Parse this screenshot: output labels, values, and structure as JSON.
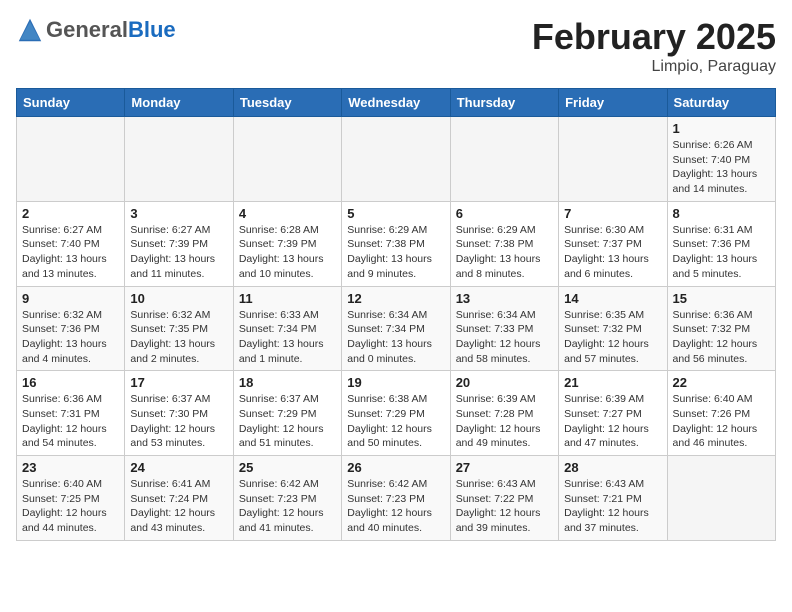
{
  "header": {
    "logo_general": "General",
    "logo_blue": "Blue",
    "month_title": "February 2025",
    "location": "Limpio, Paraguay"
  },
  "days_of_week": [
    "Sunday",
    "Monday",
    "Tuesday",
    "Wednesday",
    "Thursday",
    "Friday",
    "Saturday"
  ],
  "weeks": [
    [
      {
        "day": "",
        "info": ""
      },
      {
        "day": "",
        "info": ""
      },
      {
        "day": "",
        "info": ""
      },
      {
        "day": "",
        "info": ""
      },
      {
        "day": "",
        "info": ""
      },
      {
        "day": "",
        "info": ""
      },
      {
        "day": "1",
        "info": "Sunrise: 6:26 AM\nSunset: 7:40 PM\nDaylight: 13 hours and 14 minutes."
      }
    ],
    [
      {
        "day": "2",
        "info": "Sunrise: 6:27 AM\nSunset: 7:40 PM\nDaylight: 13 hours and 13 minutes."
      },
      {
        "day": "3",
        "info": "Sunrise: 6:27 AM\nSunset: 7:39 PM\nDaylight: 13 hours and 11 minutes."
      },
      {
        "day": "4",
        "info": "Sunrise: 6:28 AM\nSunset: 7:39 PM\nDaylight: 13 hours and 10 minutes."
      },
      {
        "day": "5",
        "info": "Sunrise: 6:29 AM\nSunset: 7:38 PM\nDaylight: 13 hours and 9 minutes."
      },
      {
        "day": "6",
        "info": "Sunrise: 6:29 AM\nSunset: 7:38 PM\nDaylight: 13 hours and 8 minutes."
      },
      {
        "day": "7",
        "info": "Sunrise: 6:30 AM\nSunset: 7:37 PM\nDaylight: 13 hours and 6 minutes."
      },
      {
        "day": "8",
        "info": "Sunrise: 6:31 AM\nSunset: 7:36 PM\nDaylight: 13 hours and 5 minutes."
      }
    ],
    [
      {
        "day": "9",
        "info": "Sunrise: 6:32 AM\nSunset: 7:36 PM\nDaylight: 13 hours and 4 minutes."
      },
      {
        "day": "10",
        "info": "Sunrise: 6:32 AM\nSunset: 7:35 PM\nDaylight: 13 hours and 2 minutes."
      },
      {
        "day": "11",
        "info": "Sunrise: 6:33 AM\nSunset: 7:34 PM\nDaylight: 13 hours and 1 minute."
      },
      {
        "day": "12",
        "info": "Sunrise: 6:34 AM\nSunset: 7:34 PM\nDaylight: 13 hours and 0 minutes."
      },
      {
        "day": "13",
        "info": "Sunrise: 6:34 AM\nSunset: 7:33 PM\nDaylight: 12 hours and 58 minutes."
      },
      {
        "day": "14",
        "info": "Sunrise: 6:35 AM\nSunset: 7:32 PM\nDaylight: 12 hours and 57 minutes."
      },
      {
        "day": "15",
        "info": "Sunrise: 6:36 AM\nSunset: 7:32 PM\nDaylight: 12 hours and 56 minutes."
      }
    ],
    [
      {
        "day": "16",
        "info": "Sunrise: 6:36 AM\nSunset: 7:31 PM\nDaylight: 12 hours and 54 minutes."
      },
      {
        "day": "17",
        "info": "Sunrise: 6:37 AM\nSunset: 7:30 PM\nDaylight: 12 hours and 53 minutes."
      },
      {
        "day": "18",
        "info": "Sunrise: 6:37 AM\nSunset: 7:29 PM\nDaylight: 12 hours and 51 minutes."
      },
      {
        "day": "19",
        "info": "Sunrise: 6:38 AM\nSunset: 7:29 PM\nDaylight: 12 hours and 50 minutes."
      },
      {
        "day": "20",
        "info": "Sunrise: 6:39 AM\nSunset: 7:28 PM\nDaylight: 12 hours and 49 minutes."
      },
      {
        "day": "21",
        "info": "Sunrise: 6:39 AM\nSunset: 7:27 PM\nDaylight: 12 hours and 47 minutes."
      },
      {
        "day": "22",
        "info": "Sunrise: 6:40 AM\nSunset: 7:26 PM\nDaylight: 12 hours and 46 minutes."
      }
    ],
    [
      {
        "day": "23",
        "info": "Sunrise: 6:40 AM\nSunset: 7:25 PM\nDaylight: 12 hours and 44 minutes."
      },
      {
        "day": "24",
        "info": "Sunrise: 6:41 AM\nSunset: 7:24 PM\nDaylight: 12 hours and 43 minutes."
      },
      {
        "day": "25",
        "info": "Sunrise: 6:42 AM\nSunset: 7:23 PM\nDaylight: 12 hours and 41 minutes."
      },
      {
        "day": "26",
        "info": "Sunrise: 6:42 AM\nSunset: 7:23 PM\nDaylight: 12 hours and 40 minutes."
      },
      {
        "day": "27",
        "info": "Sunrise: 6:43 AM\nSunset: 7:22 PM\nDaylight: 12 hours and 39 minutes."
      },
      {
        "day": "28",
        "info": "Sunrise: 6:43 AM\nSunset: 7:21 PM\nDaylight: 12 hours and 37 minutes."
      },
      {
        "day": "",
        "info": ""
      }
    ]
  ]
}
